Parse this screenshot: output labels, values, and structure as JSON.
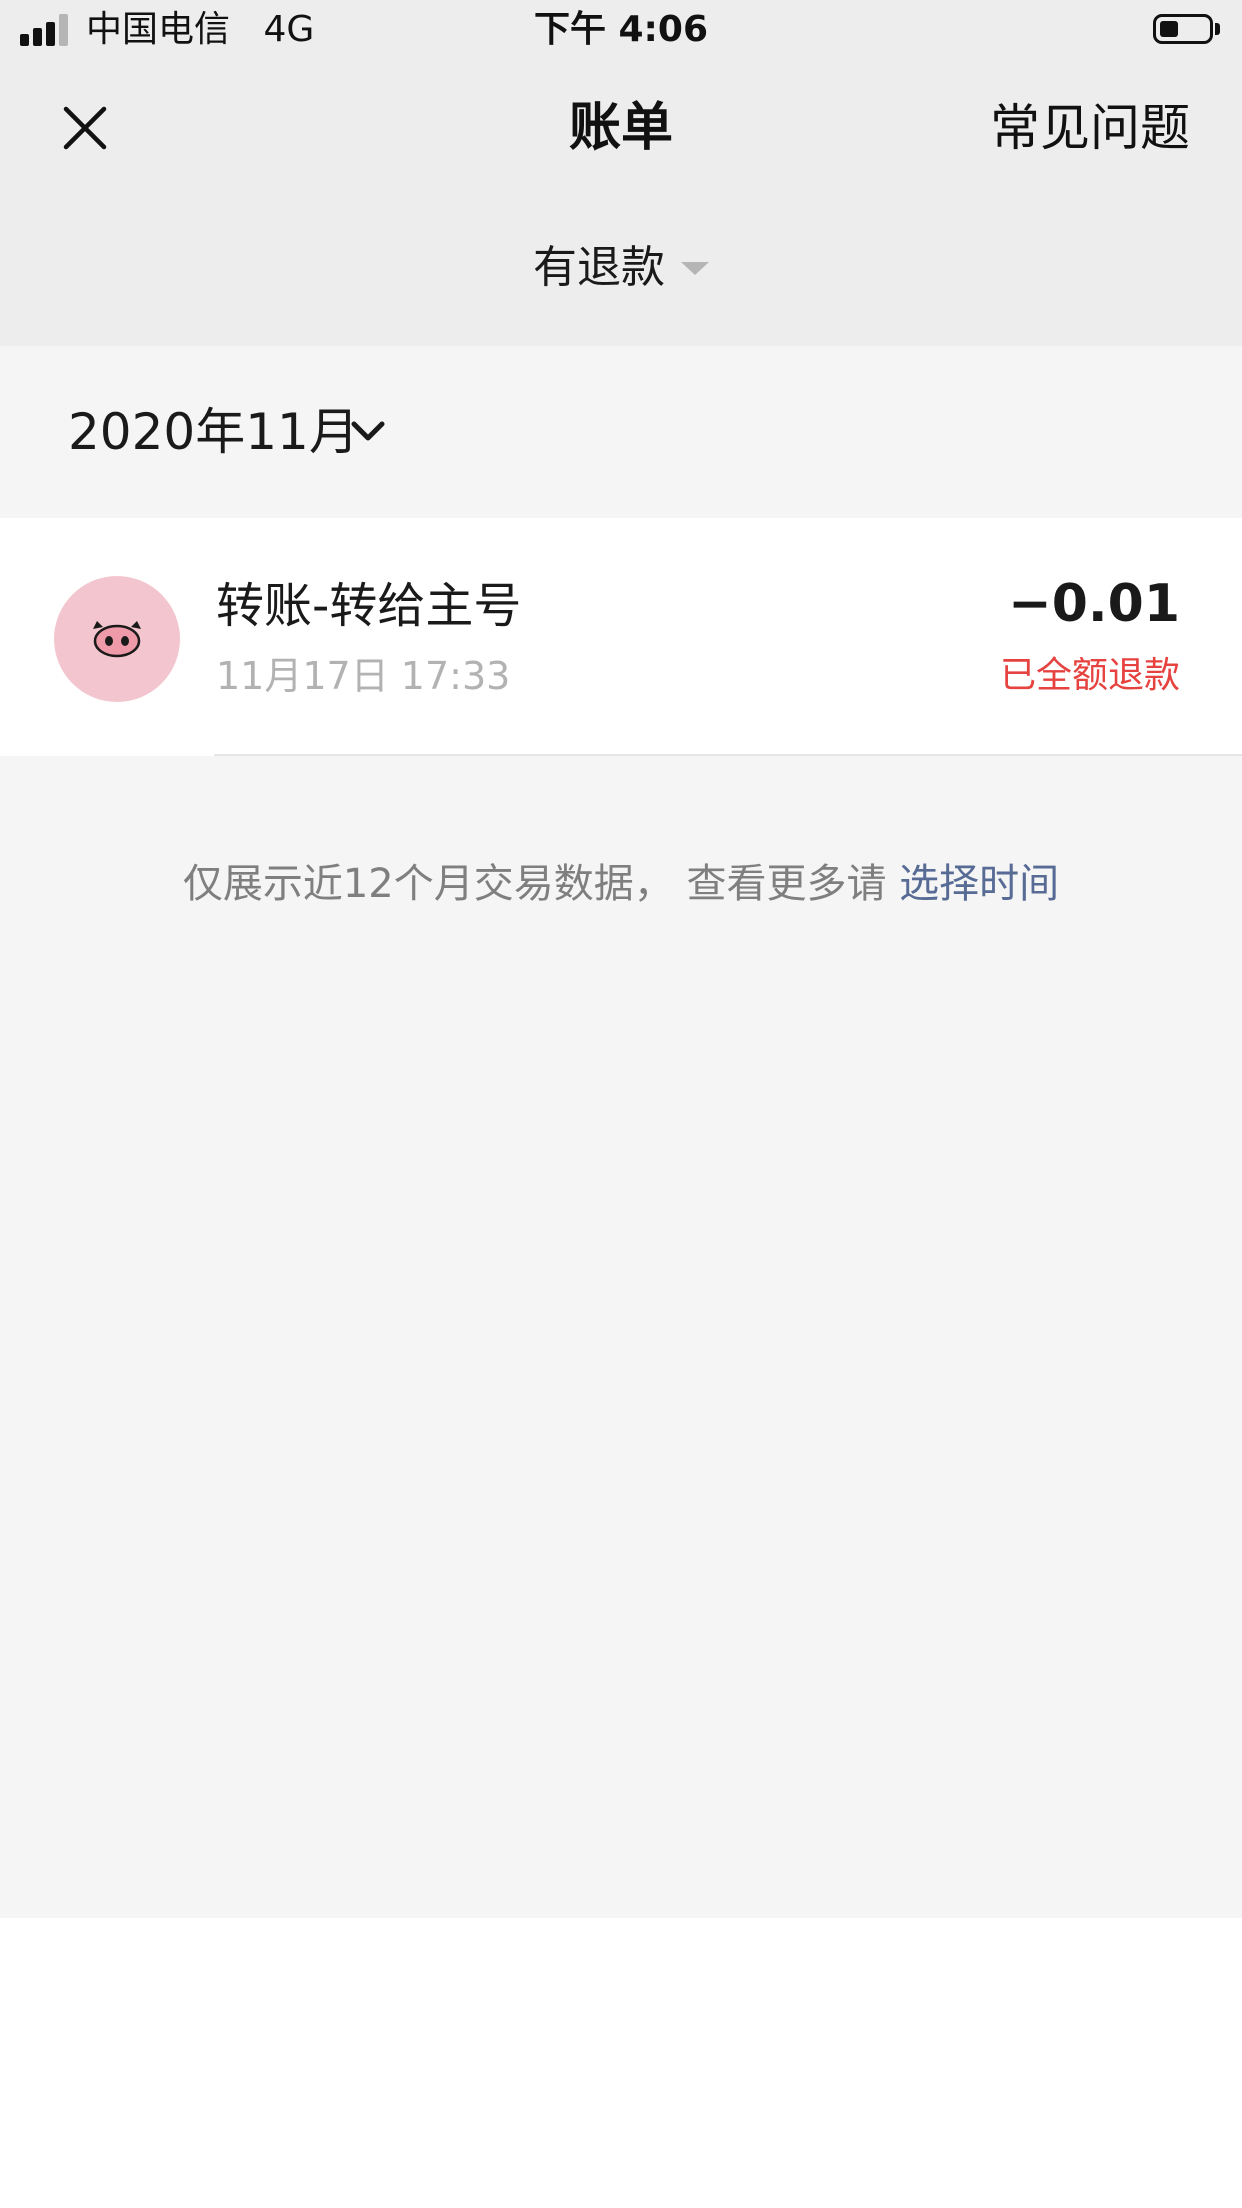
{
  "status_bar": {
    "carrier": "中国电信",
    "network": "4G",
    "time": "下午 4:06",
    "battery_level": 0.4,
    "signal_bars_filled": 3,
    "signal_bars_total": 4
  },
  "nav": {
    "title": "账单",
    "faq_label": "常见问题",
    "close_icon": "close-icon"
  },
  "filter": {
    "label": "有退款"
  },
  "month_header": {
    "label": "2020年11月"
  },
  "transactions": [
    {
      "title": "转账-转给主号",
      "time": "11月17日 17:33",
      "amount": "−0.01",
      "status": "已全额退款",
      "avatar_icon": "pig-nose-icon"
    }
  ],
  "footer_note": {
    "text": "仅展示近12个月交易数据， 查看更多请 ",
    "link_label": "选择时间"
  },
  "colors": {
    "header_bg": "#ededed",
    "page_bg": "#f5f5f5",
    "refund_status": "#e64340",
    "link": "#576b95",
    "avatar_bg": "#f3c6cf"
  }
}
